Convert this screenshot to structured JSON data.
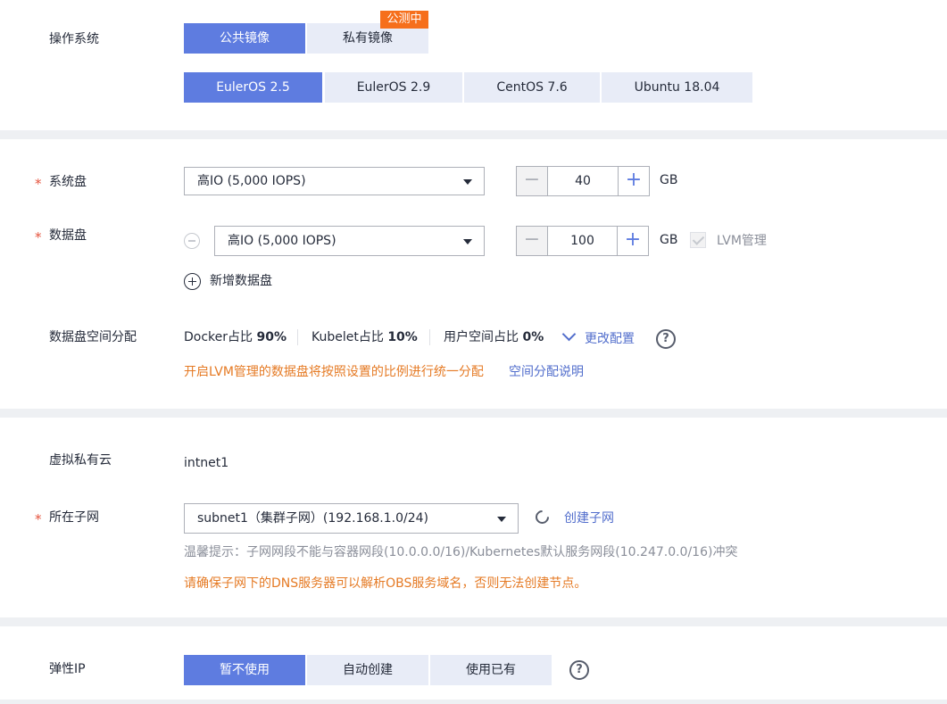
{
  "os": {
    "label": "操作系统",
    "image_tabs": [
      {
        "label": "公共镜像",
        "active": true
      },
      {
        "label": "私有镜像",
        "active": false
      }
    ],
    "beta_badge": "公测中",
    "versions": [
      {
        "label": "EulerOS 2.5",
        "active": true
      },
      {
        "label": "EulerOS 2.9",
        "active": false
      },
      {
        "label": "CentOS 7.6",
        "active": false
      },
      {
        "label": "Ubuntu 18.04",
        "active": false
      }
    ]
  },
  "disk": {
    "required_mark": "*",
    "system_label": "系统盘",
    "system_type": "高IO (5,000 IOPS)",
    "system_size": "40",
    "data_label": "数据盘",
    "data_type": "高IO (5,000 IOPS)",
    "data_size": "100",
    "unit": "GB",
    "lvm_label": "LVM管理",
    "add_data_disk": "新增数据盘",
    "alloc_label": "数据盘空间分配",
    "alloc": {
      "docker_label": "Docker占比",
      "docker_value": "90%",
      "kubelet_label": "Kubelet占比",
      "kubelet_value": "10%",
      "user_label": "用户空间占比",
      "user_value": "0%"
    },
    "change_config": "更改配置",
    "lvm_notice": "开启LVM管理的数据盘将按照设置的比例进行统一分配",
    "alloc_help_link": "空间分配说明"
  },
  "network": {
    "vpc_label": "虚拟私有云",
    "vpc_value": "intnet1",
    "subnet_label": "所在子网",
    "subnet_value": "subnet1（集群子网）(192.168.1.0/24)",
    "create_subnet": "创建子网",
    "tip": "温馨提示：子网网段不能与容器网段(10.0.0.0/16)/Kubernetes默认服务网段(10.247.0.0/16)冲突",
    "dns_warning": "请确保子网下的DNS服务器可以解析OBS服务域名，否则无法创建节点。"
  },
  "eip": {
    "label": "弹性IP",
    "options": [
      {
        "label": "暂不使用",
        "active": true
      },
      {
        "label": "自动创建",
        "active": false
      },
      {
        "label": "使用已有",
        "active": false
      }
    ]
  },
  "icons": {
    "help": "question-circle-icon",
    "refresh": "refresh-icon",
    "add": "plus-circle-icon",
    "remove": "minus-circle-icon",
    "expand": "chevron-down-icon",
    "dropdown": "caret-down-icon"
  },
  "colors": {
    "accent": "#5e7ce0",
    "tab_inactive": "#e8ecf7",
    "warning": "#e57a24",
    "required": "#e5533d",
    "badge": "#f66f1c",
    "link": "#526ecc"
  }
}
